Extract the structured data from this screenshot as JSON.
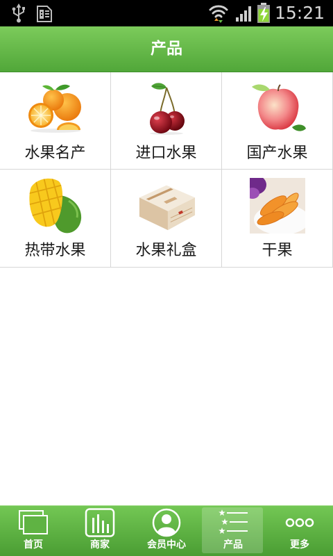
{
  "status_bar": {
    "time": "15:21",
    "left_icons": [
      "usb-icon",
      "sim-notification-icon"
    ],
    "right_icons": [
      "wifi-icon",
      "signal-icon",
      "battery-charging-icon"
    ]
  },
  "header": {
    "title": "产品"
  },
  "categories": [
    {
      "label": "水果名产",
      "image": "oranges-image"
    },
    {
      "label": "进口水果",
      "image": "cherries-image"
    },
    {
      "label": "国产水果",
      "image": "apple-image"
    },
    {
      "label": "热带水果",
      "image": "mango-image"
    },
    {
      "label": "水果礼盒",
      "image": "gift-box-image"
    },
    {
      "label": "干果",
      "image": "dried-fruit-image"
    }
  ],
  "tab_bar": {
    "tabs": [
      {
        "label": "首页",
        "icon": "home-icon",
        "active": false
      },
      {
        "label": "商家",
        "icon": "merchant-icon",
        "active": false
      },
      {
        "label": "会员中心",
        "icon": "member-icon",
        "active": false
      },
      {
        "label": "产品",
        "icon": "products-icon",
        "active": true
      },
      {
        "label": "更多",
        "icon": "more-icon",
        "active": false
      }
    ]
  },
  "colors": {
    "header_green": "#5db341",
    "tab_bar_green": "#5aae3e",
    "grid_line": "#d6d6d6",
    "label_text": "#1a1a1a",
    "status_bar": "#000000"
  }
}
